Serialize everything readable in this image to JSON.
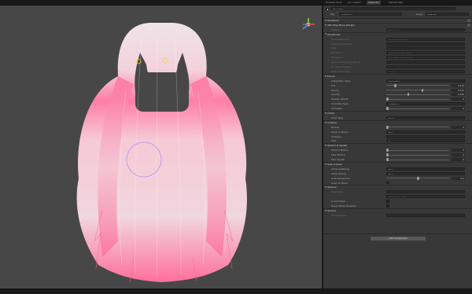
{
  "top_tabs": [
    "Problem Tools",
    "Ani Creator",
    "Inspector",
    "VRChat SDK"
  ],
  "object_name": "hair_pink",
  "tag": "Untagged",
  "layer": "Default",
  "component": "VRC Phys Bone (Script)",
  "version": "Version 1.1",
  "rows": [
    {
      "type": "head",
      "label": "Transform"
    },
    {
      "type": "head",
      "label": "VRC Phys Bone (Script)"
    },
    {
      "type": "field",
      "label": "Version",
      "value": "Version 1.1",
      "dim": true
    },
    {
      "type": "head",
      "label": "Transforms"
    },
    {
      "type": "field",
      "label": "Root Transform",
      "value": "None (Transform)",
      "dim": true
    },
    {
      "type": "field",
      "label": "Ignore Transforms",
      "value": "",
      "dim": true
    },
    {
      "type": "field",
      "label": "Size",
      "value": "2",
      "dim": true
    },
    {
      "type": "field",
      "label": "Element 0",
      "value": "Hair_Front (Transform)",
      "dim": true
    },
    {
      "type": "field",
      "label": "Element 1",
      "value": "Hair_Back (Transform)",
      "dim": true
    },
    {
      "type": "field",
      "label": "Ignore Other Phys Bones",
      "value": "",
      "dim": true
    },
    {
      "type": "field",
      "label": "Endpoint Position",
      "value": "",
      "dim": true
    },
    {
      "type": "field",
      "label": "Multi Child Type",
      "value": "Ignore",
      "dim": true
    },
    {
      "type": "head",
      "label": "Forces"
    },
    {
      "type": "field",
      "label": "Integration Type",
      "value": "Simplified"
    },
    {
      "type": "slider",
      "label": "Pull",
      "value": "0.130",
      "pos": 0.13
    },
    {
      "type": "slider",
      "label": "Spring",
      "value": "0.575",
      "pos": 0.575
    },
    {
      "type": "slider",
      "label": "Gravity",
      "value": "0.344",
      "pos": 0.344
    },
    {
      "type": "slider",
      "label": "Gravity Falloff",
      "value": "0",
      "pos": 0.0
    },
    {
      "type": "field",
      "label": "Immobile Type",
      "value": "All Motion"
    },
    {
      "type": "slider",
      "label": "Immobile",
      "value": "0",
      "pos": 0.0
    },
    {
      "type": "head",
      "label": "Limits"
    },
    {
      "type": "field",
      "label": "Limit Type",
      "value": "None"
    },
    {
      "type": "head",
      "label": "Collision"
    },
    {
      "type": "slider",
      "label": "Radius",
      "value": "0",
      "pos": 0.0
    },
    {
      "type": "field",
      "label": "Allow Collision",
      "value": "True"
    },
    {
      "type": "field",
      "label": "Colliders",
      "value": ""
    },
    {
      "type": "field",
      "label": "Size",
      "value": "0"
    },
    {
      "type": "head",
      "label": "Stretch & Squish"
    },
    {
      "type": "slider",
      "label": "Stretch Motion",
      "value": "0",
      "pos": 0.0
    },
    {
      "type": "slider",
      "label": "Max Stretch",
      "value": "0",
      "pos": 0.0
    },
    {
      "type": "slider",
      "label": "Max Squish",
      "value": "0",
      "pos": 0.0
    },
    {
      "type": "head",
      "label": "Grab & Pose"
    },
    {
      "type": "field",
      "label": "Allow Grabbing",
      "value": "True"
    },
    {
      "type": "field",
      "label": "Allow Posing",
      "value": "True"
    },
    {
      "type": "slider",
      "label": "Grab Movement",
      "value": "0.5",
      "pos": 0.5
    },
    {
      "type": "check",
      "label": "Snap To Hand",
      "on": false
    },
    {
      "type": "head",
      "label": "Options"
    },
    {
      "type": "field",
      "label": "Parameter",
      "value": "",
      "dim": true
    },
    {
      "type": "field",
      "label": "",
      "value": "Parameter prefix ...",
      "dim": true
    },
    {
      "type": "check",
      "label": "Is Animated",
      "on": false
    },
    {
      "type": "check",
      "label": "Reset When Disabled",
      "on": false
    },
    {
      "type": "head",
      "label": "Gizmos"
    },
    {
      "type": "field",
      "label": "Show Gizmos",
      "value": "",
      "dim": true
    }
  ],
  "add_component": "Add Component",
  "colors": {
    "hair_pink": "#ff6f9a",
    "hair_white": "#f4e6ea",
    "scene_bg": "#474747",
    "panel_bg": "#383838"
  }
}
